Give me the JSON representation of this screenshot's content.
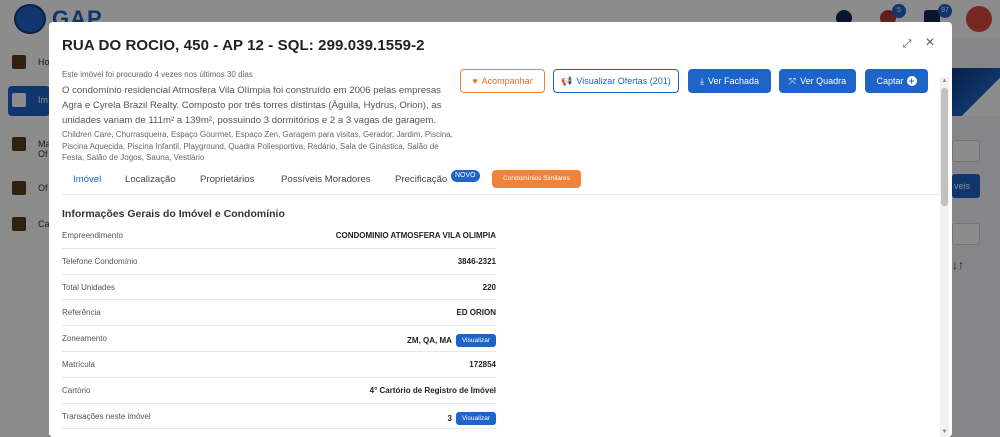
{
  "background": {
    "app_name": "GAP",
    "badges": [
      "5",
      "97"
    ],
    "sidebar": [
      {
        "label": "Ho"
      },
      {
        "label": "Im"
      },
      {
        "label": "Ma Of"
      },
      {
        "label": "Of"
      },
      {
        "label": "Ca"
      }
    ],
    "right_button_label": "veis",
    "sort_label": "↓↑"
  },
  "modal": {
    "title": "RUA DO ROCIO, 450 - AP 12 - SQL: 299.039.1559-2",
    "searched_note": "Este imóvel foi procurado 4 vezes nos últimos 30 dias",
    "description": "O condomínio residencial Atmosfera Vila Olímpia foi construído em 2006 pelas empresas Agra e Cyrela Brazil Realty. Composto por três torres distintas (Águila, Hydrus, Orion), as unidades variam de 111m² a 139m², possuindo 3 dormitórios e 2 a 3 vagas de garagem.",
    "amenities": "Children Care, Churrasqueira, Espaço Gourmet, Espaço Zen, Garagem para visitas, Gerador, Jardim, Piscina, Piscina Aquecida, Piscina Infantil, Playground, Quadra Poliesportiva, Redário, Sala de Ginástica, Salão de Festa, Salão de Jogos, Sauna, Vestiário",
    "actions": {
      "follow": "Acompanhar",
      "offers": "Visualizar Ofertas (201)",
      "facade": "Ver Fachada",
      "quadra": "Ver Quadra",
      "captar": "Captar"
    },
    "tabs": [
      {
        "label": "Imóvel"
      },
      {
        "label": "Localização"
      },
      {
        "label": "Proprietários"
      },
      {
        "label": "Possíveis Moradores"
      },
      {
        "label": "Precificação"
      }
    ],
    "tab_badge": "NOVO",
    "similar_button": "Condomínios Similares",
    "section_title": "Informações Gerais do Imóvel e Condomínio",
    "rows": [
      {
        "label": "Empreendimento",
        "value": "CONDOMINIO ATMOSFERA VILA OLIMPIA"
      },
      {
        "label": "Telefone Condomínio",
        "value": "3846-2321"
      },
      {
        "label": "Total Unidades",
        "value": "220"
      },
      {
        "label": "Referência",
        "value": "ED ORION"
      },
      {
        "label": "Zoneamento",
        "value": "ZM, QA, MA",
        "button": "Visualizar"
      },
      {
        "label": "Matrícula",
        "value": "172854"
      },
      {
        "label": "Cartório",
        "value": "4° Cartório de Registro de Imóvel"
      },
      {
        "label": "Transações neste imóvel",
        "value": "3",
        "button": "Visualizar"
      }
    ]
  },
  "colors": {
    "primary": "#1e63c6",
    "accent_orange": "#f0833a"
  }
}
